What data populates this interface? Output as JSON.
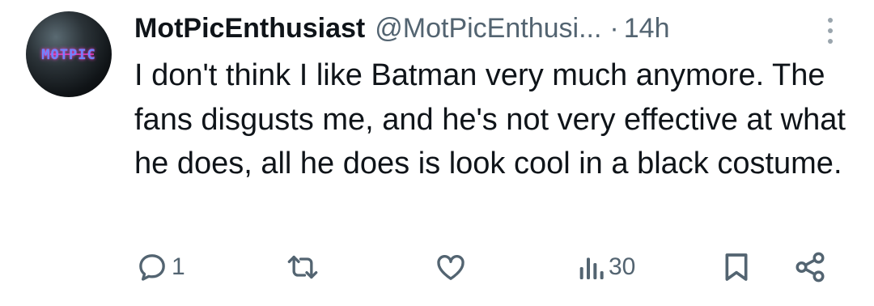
{
  "author": {
    "display_name": "MotPicEnthusiast",
    "handle": "@MotPicEnthusi...",
    "separator": "·",
    "time": "14h",
    "avatar_logo": "MOTPIC"
  },
  "tweet": {
    "text": "I don't think I like Batman very much anymore. The fans disgusts me, and he's not very effective at what he does, all he does is look cool in a black costume."
  },
  "actions": {
    "reply_count": "1",
    "repost_count": "",
    "like_count": "",
    "views_count": "30"
  },
  "icons": {
    "reply": "reply-icon",
    "repost": "repost-icon",
    "like": "heart-icon",
    "views": "views-icon",
    "bookmark": "bookmark-icon",
    "share": "share-icon",
    "more": "more-options-icon"
  },
  "colors": {
    "text": "#0f1419",
    "secondary": "#536471"
  }
}
